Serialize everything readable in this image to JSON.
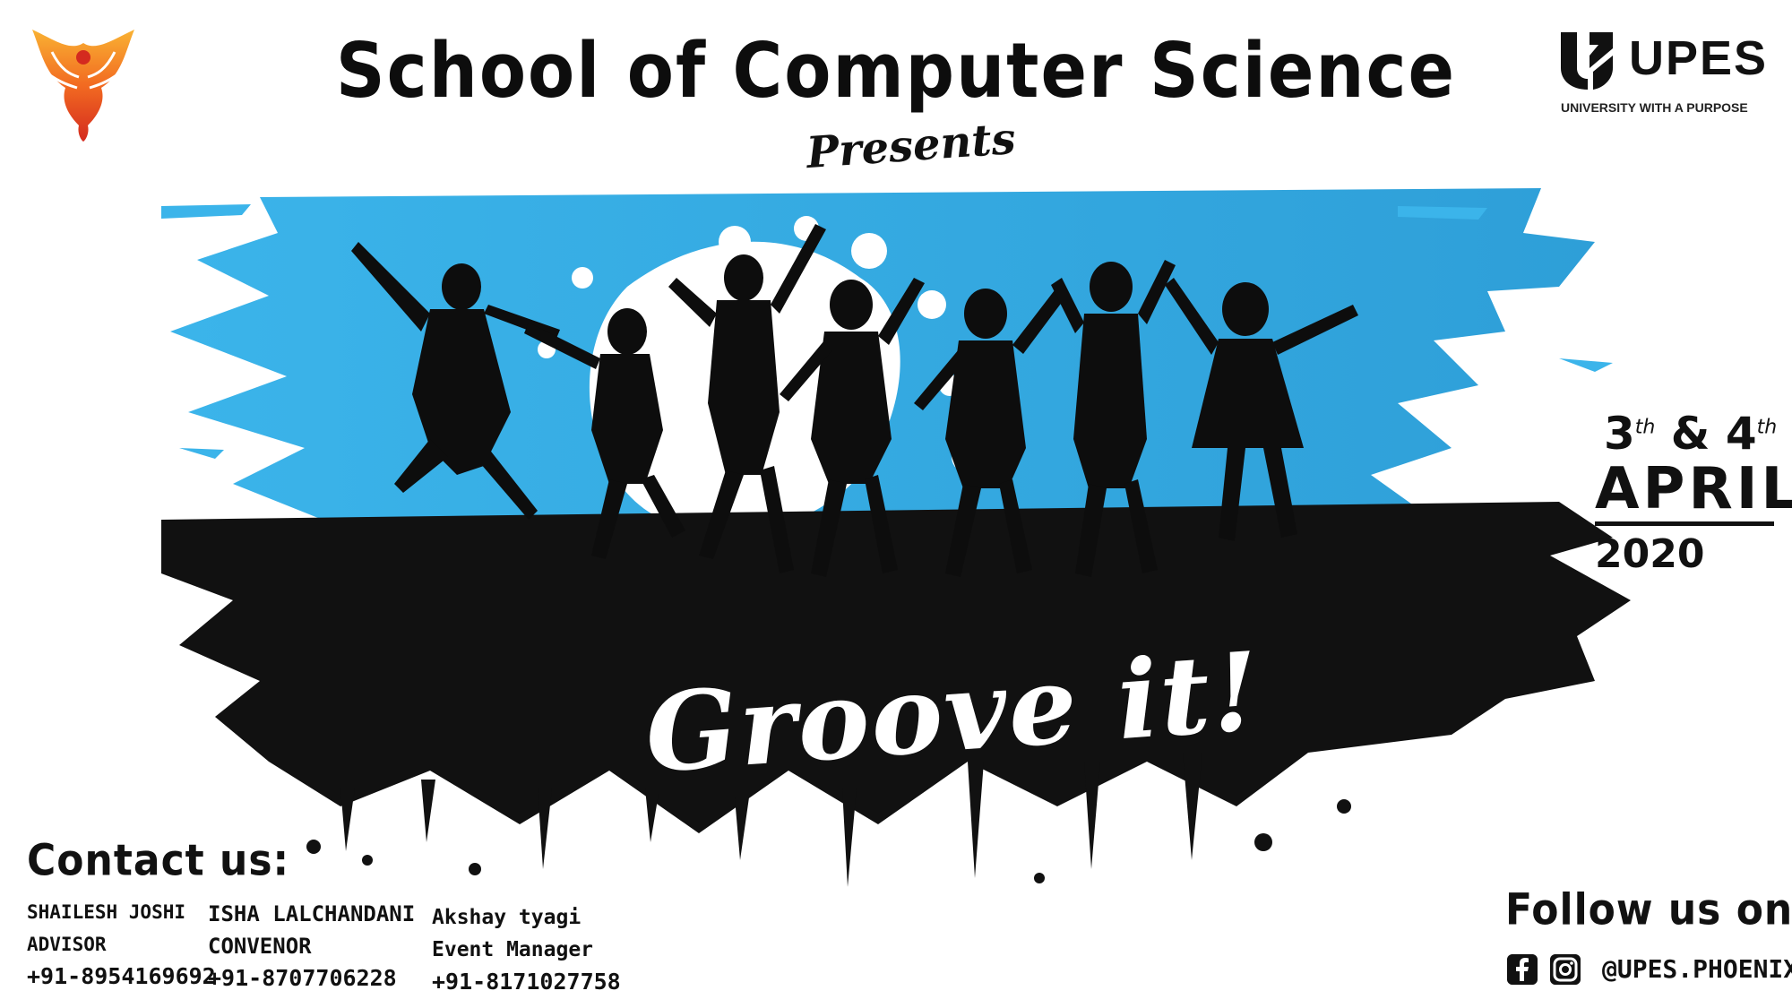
{
  "header": {
    "title": "School of Computer Science",
    "presents": "Presents"
  },
  "brand": {
    "upes_name": "UPES",
    "upes_tagline": "UNIVERSITY WITH A PURPOSE"
  },
  "event": {
    "name": "Groove it!",
    "day_1": "3",
    "day_1_suffix": "th",
    "connector": "&",
    "day_2": "4",
    "day_2_suffix": "th",
    "month": "APRIL",
    "year": "2020"
  },
  "contact": {
    "heading": "Contact us:",
    "people": [
      {
        "name": "SHAILESH JOSHI",
        "role": "ADVISOR",
        "phone": "+91-8954169692"
      },
      {
        "name": "ISHA LALCHANDANI",
        "role": "CONVENOR",
        "phone": "+91-8707706228"
      },
      {
        "name": "Akshay tyagi",
        "role": "Event Manager",
        "phone": "+91-8171027758"
      }
    ]
  },
  "follow": {
    "heading": "Follow us on:",
    "handle": "@UPES.PHOENIX",
    "icons": [
      "facebook-icon",
      "instagram-icon"
    ]
  },
  "colors": {
    "sky_blue": "#3bb4ea",
    "ink": "#111111",
    "phoenix_orange": "#f26a21",
    "phoenix_red": "#d42a1f",
    "phoenix_yellow": "#f9b233"
  }
}
